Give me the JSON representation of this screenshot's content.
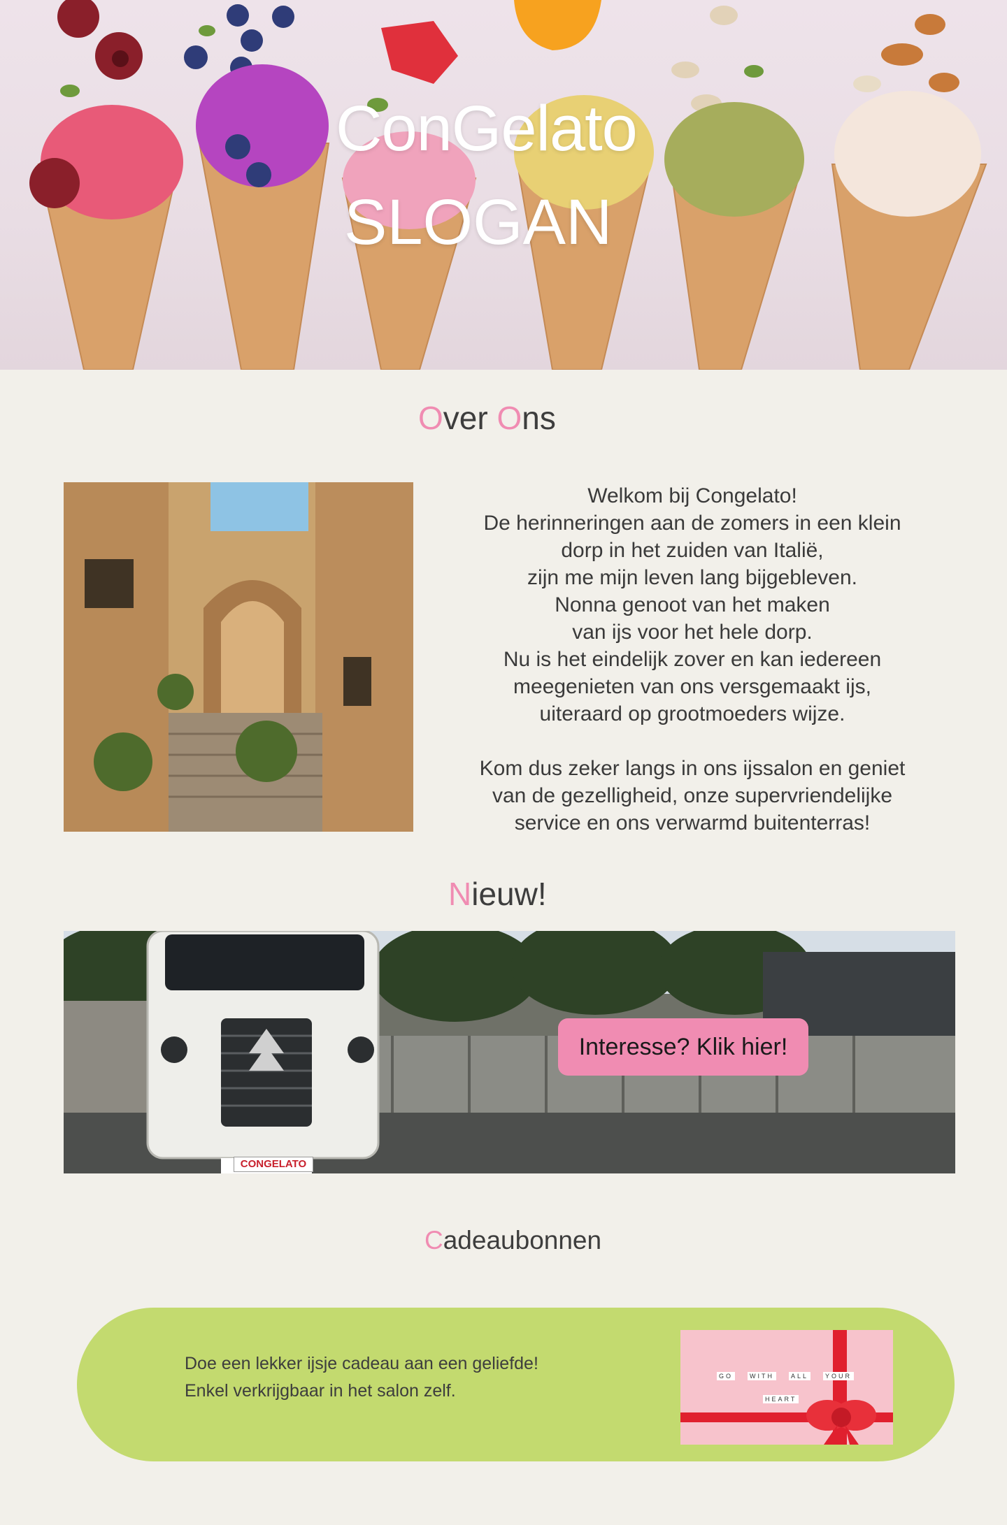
{
  "hero": {
    "title": "ConGelato",
    "slogan": "SLOGAN"
  },
  "sections": {
    "about": {
      "first_letter": "O",
      "rest_1": "ver ",
      "second_letter": "O",
      "rest_2": "ns"
    },
    "new": {
      "first_letter": "N",
      "rest": "ieuw!"
    },
    "gift": {
      "first_letter": "C",
      "rest": "adeaubonnen"
    }
  },
  "about_text": {
    "lines_1": [
      "Welkom bij Congelato!",
      "De herinneringen aan de zomers in een klein",
      "dorp in het zuiden van Italië,",
      "zijn me mijn leven lang bijgebleven.",
      "Nonna genoot van het maken",
      "van ijs voor het hele dorp.",
      "Nu is het eindelijk zover en kan iedereen",
      "meegenieten van ons versgemaakt ijs,",
      "uiteraard op grootmoeders wijze."
    ],
    "lines_2": [
      "Kom dus zeker langs in ons ijssalon en geniet",
      "van de gezelligheid, onze supervriendelijke",
      "service en ons verwarmd buitenterras!"
    ]
  },
  "new_section": {
    "cta_label": "Interesse? Klik hier!",
    "truck_plate": "CONGELATO"
  },
  "gift_section": {
    "line_1": "Doe een lekker ijsje cadeau aan een geliefde!",
    "line_2": "Enkel verkrijgbaar in het salon zelf.",
    "card_words_1": [
      "GO",
      "WITH",
      "ALL",
      "YOUR"
    ],
    "card_words_2": [
      "HEART"
    ]
  },
  "colors": {
    "background": "#f2f0ea",
    "accent_pink": "#f08cb2",
    "gift_green": "#c3da6f"
  }
}
